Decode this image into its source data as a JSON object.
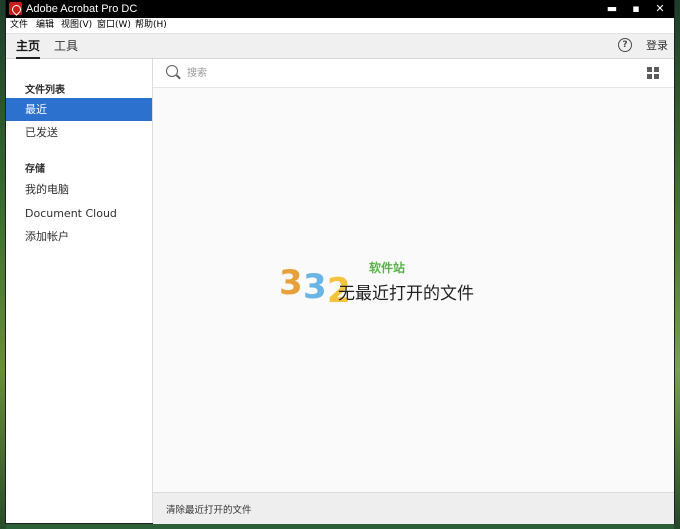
{
  "window": {
    "title": "Adobe Acrobat Pro DC",
    "controls": {
      "minimize": "▬",
      "maximize": "▪",
      "close": "✕"
    }
  },
  "menubar": {
    "items": [
      {
        "label": "文件"
      },
      {
        "label": "编辑"
      },
      {
        "label": "视图(V)"
      },
      {
        "label": "窗口(W)"
      },
      {
        "label": "帮助(H)"
      }
    ]
  },
  "tabs": [
    {
      "label": "主页",
      "selected": true
    },
    {
      "label": "工具",
      "selected": false
    }
  ],
  "header": {
    "help_icon": "question-circle-icon",
    "help_glyph": "?",
    "signin_label": "登录"
  },
  "sidebar": {
    "sections": [
      {
        "heading": "文件列表",
        "items": [
          {
            "label": "最近",
            "selected": true
          },
          {
            "label": "已发送",
            "selected": false
          }
        ]
      },
      {
        "heading": "存储",
        "items": [
          {
            "label": "我的电脑"
          },
          {
            "label": "Document Cloud"
          },
          {
            "label": "添加帐户"
          }
        ]
      }
    ]
  },
  "main": {
    "search": {
      "placeholder": "搜索",
      "value": ""
    },
    "view_toggle_icon": "grid-view-icon",
    "empty_message": "无最近打开的文件",
    "footer": {
      "clear_label": "清除最近打开的文件"
    }
  },
  "watermark": {
    "digits": [
      "3",
      "3",
      "2"
    ],
    "text": "软件站"
  },
  "colors": {
    "titlebar": "#000000",
    "selected_item": "#2d71ce",
    "app_icon": "#c41e1e"
  }
}
